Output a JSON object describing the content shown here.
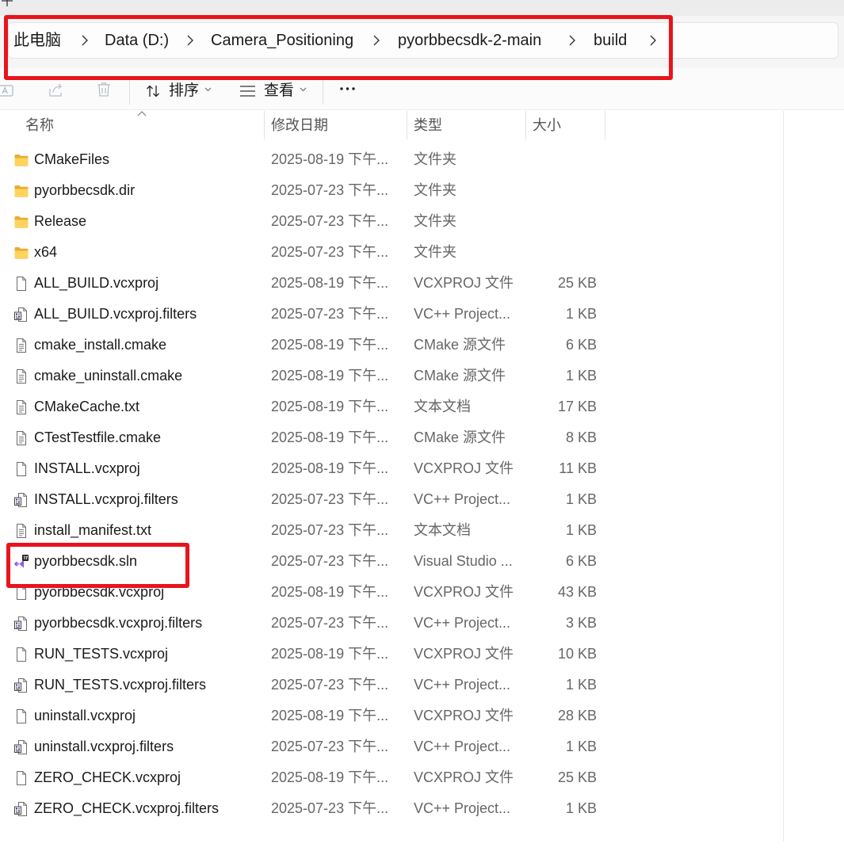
{
  "window": {
    "new_tab_icon": "plus-icon"
  },
  "address_bar": {
    "separator_icon": "chevron-right-icon",
    "breadcrumb": [
      {
        "label": "此电脑"
      },
      {
        "label": "Data (D:)"
      },
      {
        "label": "Camera_Positioning"
      },
      {
        "label": "pyorbbecsdk-2-main"
      },
      {
        "label": "build"
      }
    ]
  },
  "toolbar": {
    "icons": [
      "rename-icon",
      "share-icon",
      "delete-icon",
      "sort-icon",
      "view-icon",
      "more-icon"
    ],
    "sort_label": "排序",
    "view_label": "查看"
  },
  "columns": {
    "name": "名称",
    "modified": "修改日期",
    "type": "类型",
    "size": "大小",
    "sort_indicator_icon": "chevron-up-icon"
  },
  "files": [
    {
      "icon": "folder-icon",
      "name": "CMakeFiles",
      "modified": "2025-08-19 下午...",
      "type": "文件夹"
    },
    {
      "icon": "folder-icon",
      "name": "pyorbbecsdk.dir",
      "modified": "2025-07-23 下午...",
      "type": "文件夹"
    },
    {
      "icon": "folder-icon",
      "name": "Release",
      "modified": "2025-07-23 下午...",
      "type": "文件夹"
    },
    {
      "icon": "folder-icon",
      "name": "x64",
      "modified": "2025-07-23 下午...",
      "type": "文件夹"
    },
    {
      "icon": "blank-file-icon",
      "name": "ALL_BUILD.vcxproj",
      "modified": "2025-08-19 下午...",
      "type": "VCXPROJ 文件",
      "size": "25 KB"
    },
    {
      "icon": "vcxproj-filters-icon",
      "name": "ALL_BUILD.vcxproj.filters",
      "modified": "2025-07-23 下午...",
      "type": "VC++ Project...",
      "size": "1 KB"
    },
    {
      "icon": "text-file-icon",
      "name": "cmake_install.cmake",
      "modified": "2025-08-19 下午...",
      "type": "CMake 源文件",
      "size": "6 KB"
    },
    {
      "icon": "text-file-icon",
      "name": "cmake_uninstall.cmake",
      "modified": "2025-08-19 下午...",
      "type": "CMake 源文件",
      "size": "1 KB"
    },
    {
      "icon": "text-file-icon",
      "name": "CMakeCache.txt",
      "modified": "2025-08-19 下午...",
      "type": "文本文档",
      "size": "17 KB"
    },
    {
      "icon": "text-file-icon",
      "name": "CTestTestfile.cmake",
      "modified": "2025-08-19 下午...",
      "type": "CMake 源文件",
      "size": "8 KB"
    },
    {
      "icon": "blank-file-icon",
      "name": "INSTALL.vcxproj",
      "modified": "2025-08-19 下午...",
      "type": "VCXPROJ 文件",
      "size": "11 KB"
    },
    {
      "icon": "vcxproj-filters-icon",
      "name": "INSTALL.vcxproj.filters",
      "modified": "2025-07-23 下午...",
      "type": "VC++ Project...",
      "size": "1 KB"
    },
    {
      "icon": "text-file-icon",
      "name": "install_manifest.txt",
      "modified": "2025-07-23 下午...",
      "type": "文本文档",
      "size": "1 KB"
    },
    {
      "icon": "visual-studio-solution-icon",
      "name": "pyorbbecsdk.sln",
      "modified": "2025-07-23 下午...",
      "type": "Visual Studio ...",
      "size": "6 KB"
    },
    {
      "icon": "blank-file-icon",
      "name": "pyorbbecsdk.vcxproj",
      "modified": "2025-08-19 下午...",
      "type": "VCXPROJ 文件",
      "size": "43 KB"
    },
    {
      "icon": "vcxproj-filters-icon",
      "name": "pyorbbecsdk.vcxproj.filters",
      "modified": "2025-07-23 下午...",
      "type": "VC++ Project...",
      "size": "3 KB"
    },
    {
      "icon": "blank-file-icon",
      "name": "RUN_TESTS.vcxproj",
      "modified": "2025-08-19 下午...",
      "type": "VCXPROJ 文件",
      "size": "10 KB"
    },
    {
      "icon": "vcxproj-filters-icon",
      "name": "RUN_TESTS.vcxproj.filters",
      "modified": "2025-07-23 下午...",
      "type": "VC++ Project...",
      "size": "1 KB"
    },
    {
      "icon": "blank-file-icon",
      "name": "uninstall.vcxproj",
      "modified": "2025-08-19 下午...",
      "type": "VCXPROJ 文件",
      "size": "28 KB"
    },
    {
      "icon": "vcxproj-filters-icon",
      "name": "uninstall.vcxproj.filters",
      "modified": "2025-07-23 下午...",
      "type": "VC++ Project...",
      "size": "1 KB"
    },
    {
      "icon": "blank-file-icon",
      "name": "ZERO_CHECK.vcxproj",
      "modified": "2025-08-19 下午...",
      "type": "VCXPROJ 文件",
      "size": "25 KB"
    },
    {
      "icon": "vcxproj-filters-icon",
      "name": "ZERO_CHECK.vcxproj.filters",
      "modified": "2025-07-23 下午...",
      "type": "VC++ Project...",
      "size": "1 KB"
    }
  ],
  "colors": {
    "annotation": "#e8141c",
    "text": "#1a1a1a",
    "secondary_text": "#666666",
    "folder": "#ffd45e",
    "disabled_icon": "#a9b8cb"
  }
}
